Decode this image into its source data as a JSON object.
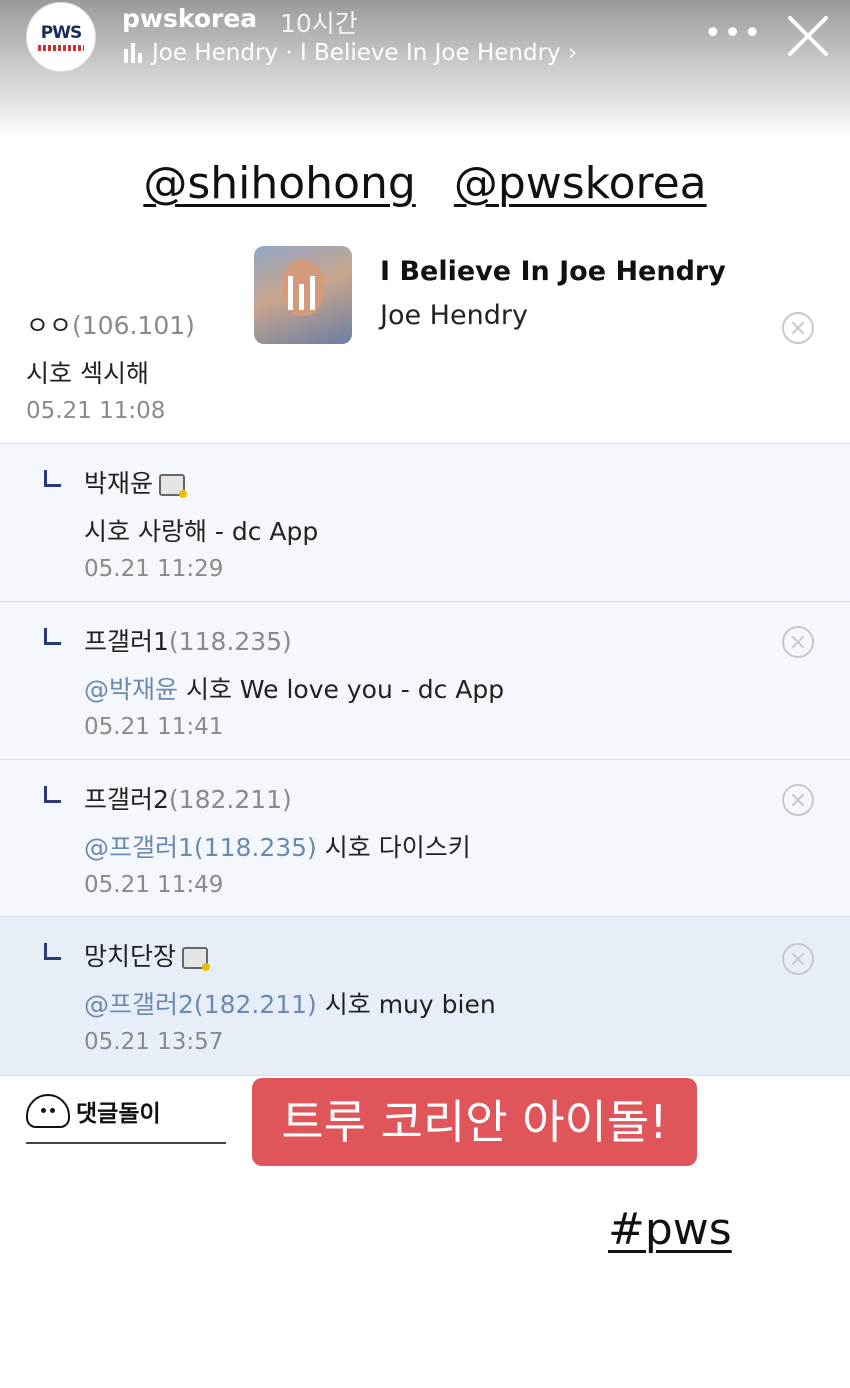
{
  "header": {
    "avatar_logo": "PWS",
    "username": "pwskorea",
    "time": "10시간",
    "music": "Joe Hendry · I Believe In Joe Hendry ›",
    "more_label": "•••"
  },
  "mentions": [
    "@shihohong",
    "@pwskorea"
  ],
  "music_sticker": {
    "title": "I Believe In Joe Hendry",
    "artist": "Joe Hendry"
  },
  "comments": [
    {
      "author": "ㅇㅇ",
      "ip": "(106.101)",
      "text": "시호 섹시해",
      "date": "05.21 11:08"
    },
    {
      "author": "박재윤",
      "text": "시호 사랑해 - dc App",
      "date": "05.21 11:29"
    },
    {
      "author": "프갤러1",
      "ip": "(118.235)",
      "mention": "@박재윤",
      "text": " 시호 We love you - dc App",
      "date": "05.21 11:41"
    },
    {
      "author": "프갤러2",
      "ip": "(182.211)",
      "mention": "@프갤러1(118.235)",
      "text": " 시호 다이스키",
      "date": "05.21 11:49"
    },
    {
      "author": "망치단장",
      "mention": "@프갤러2(182.211)",
      "text": " 시호 muy bien",
      "date": "05.21 13:57"
    }
  ],
  "footer": {
    "dolli_label": "댓글돌이"
  },
  "banner_text": "트루 코리안 아이돌!",
  "hashtag": "#pws"
}
